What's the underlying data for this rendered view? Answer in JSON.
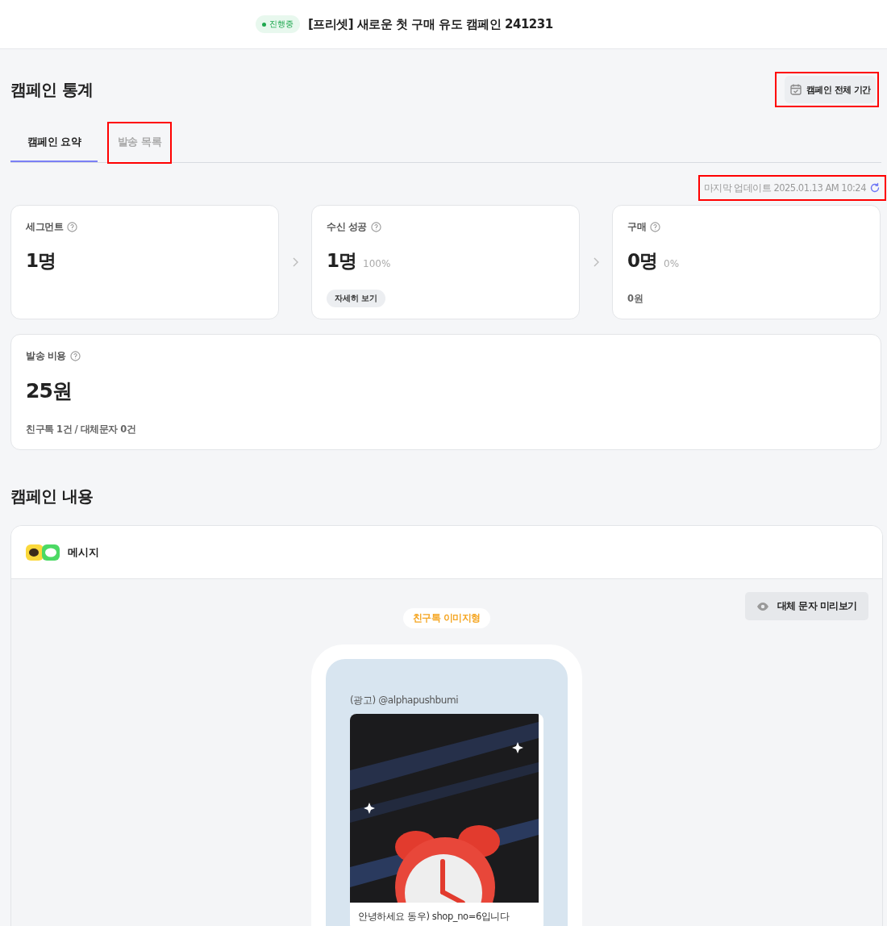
{
  "header": {
    "status": {
      "label": "진행중",
      "active": true
    },
    "title": "[프리셋] 새로운 첫 구매 유도 캠페인 241231"
  },
  "stats": {
    "title": "캠페인 통계",
    "period_button": {
      "label": "캠페인 전체 기간",
      "highlighted": true
    },
    "tabs": [
      {
        "label": "캠페인 요약",
        "selected": true,
        "highlighted": false
      },
      {
        "label": "발송 목록",
        "selected": false,
        "highlighted": true
      }
    ],
    "last_update": {
      "text": "마지막 업데이트 2025.01.13 AM 10:24",
      "highlighted": true
    },
    "cards": [
      {
        "label": "세그먼트",
        "value": "1명"
      },
      {
        "label": "수신 성공",
        "value": "1명",
        "percent": "100%",
        "link": "자세히 보기"
      },
      {
        "label": "구매",
        "value": "0명",
        "percent": "0%",
        "sub": "0원"
      }
    ],
    "cost": {
      "label": "발송 비용",
      "value": "25원",
      "sub": "친구톡 1건 / 대체문자 0건"
    }
  },
  "content": {
    "title": "캠페인 내용",
    "message_card": {
      "title": "메시지",
      "preview_button": "대체 문자 미리보기",
      "type_badge": "친구톡 이미지형",
      "phone": {
        "sender": "(광고) @alphapushbumi",
        "body": "안녕하세요 동우) shop_no=6입니다"
      }
    }
  }
}
